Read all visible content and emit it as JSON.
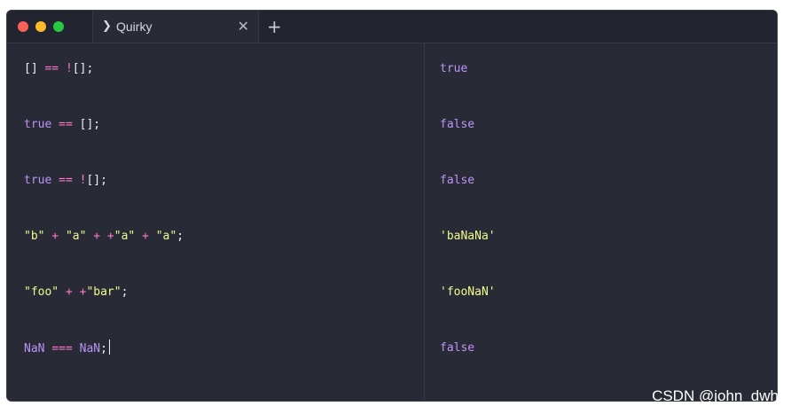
{
  "window": {
    "tab_title": "Quirky",
    "tab_chevron": "❯",
    "tab_close": "✕",
    "new_tab": "+"
  },
  "colors": {
    "background": "#282a36",
    "titlebar": "#222430",
    "operator": "#ff79c6",
    "keyword": "#bd93f9",
    "string": "#f1fa8c",
    "punctuation": "#f0f0f4"
  },
  "editor": {
    "lines": [
      [
        {
          "t": "[] ",
          "c": "punct"
        },
        {
          "t": "== !",
          "c": "op"
        },
        {
          "t": "[];",
          "c": "punct"
        }
      ],
      [
        {
          "t": "true ",
          "c": "kw"
        },
        {
          "t": "== ",
          "c": "op"
        },
        {
          "t": "[];",
          "c": "punct"
        }
      ],
      [
        {
          "t": "true ",
          "c": "kw"
        },
        {
          "t": "== !",
          "c": "op"
        },
        {
          "t": "[];",
          "c": "punct"
        }
      ],
      [
        {
          "t": "\"b\"",
          "c": "str"
        },
        {
          "t": " + ",
          "c": "op"
        },
        {
          "t": "\"a\"",
          "c": "str"
        },
        {
          "t": " + +",
          "c": "op"
        },
        {
          "t": "\"a\"",
          "c": "str"
        },
        {
          "t": " + ",
          "c": "op"
        },
        {
          "t": "\"a\"",
          "c": "str"
        },
        {
          "t": ";",
          "c": "punct"
        }
      ],
      [
        {
          "t": "\"foo\"",
          "c": "str"
        },
        {
          "t": " + +",
          "c": "op"
        },
        {
          "t": "\"bar\"",
          "c": "str"
        },
        {
          "t": ";",
          "c": "punct"
        }
      ],
      [
        {
          "t": "NaN ",
          "c": "kw"
        },
        {
          "t": "=== ",
          "c": "op"
        },
        {
          "t": "NaN",
          "c": "kw"
        },
        {
          "t": ";",
          "c": "punct"
        }
      ]
    ]
  },
  "results": {
    "lines": [
      {
        "t": "true",
        "c": "kw"
      },
      {
        "t": "false",
        "c": "kw"
      },
      {
        "t": "false",
        "c": "kw"
      },
      {
        "t": "'baNaNa'",
        "c": "str"
      },
      {
        "t": "'fooNaN'",
        "c": "str"
      },
      {
        "t": "false",
        "c": "kw"
      }
    ]
  },
  "watermark": "CSDN @john_dwh"
}
